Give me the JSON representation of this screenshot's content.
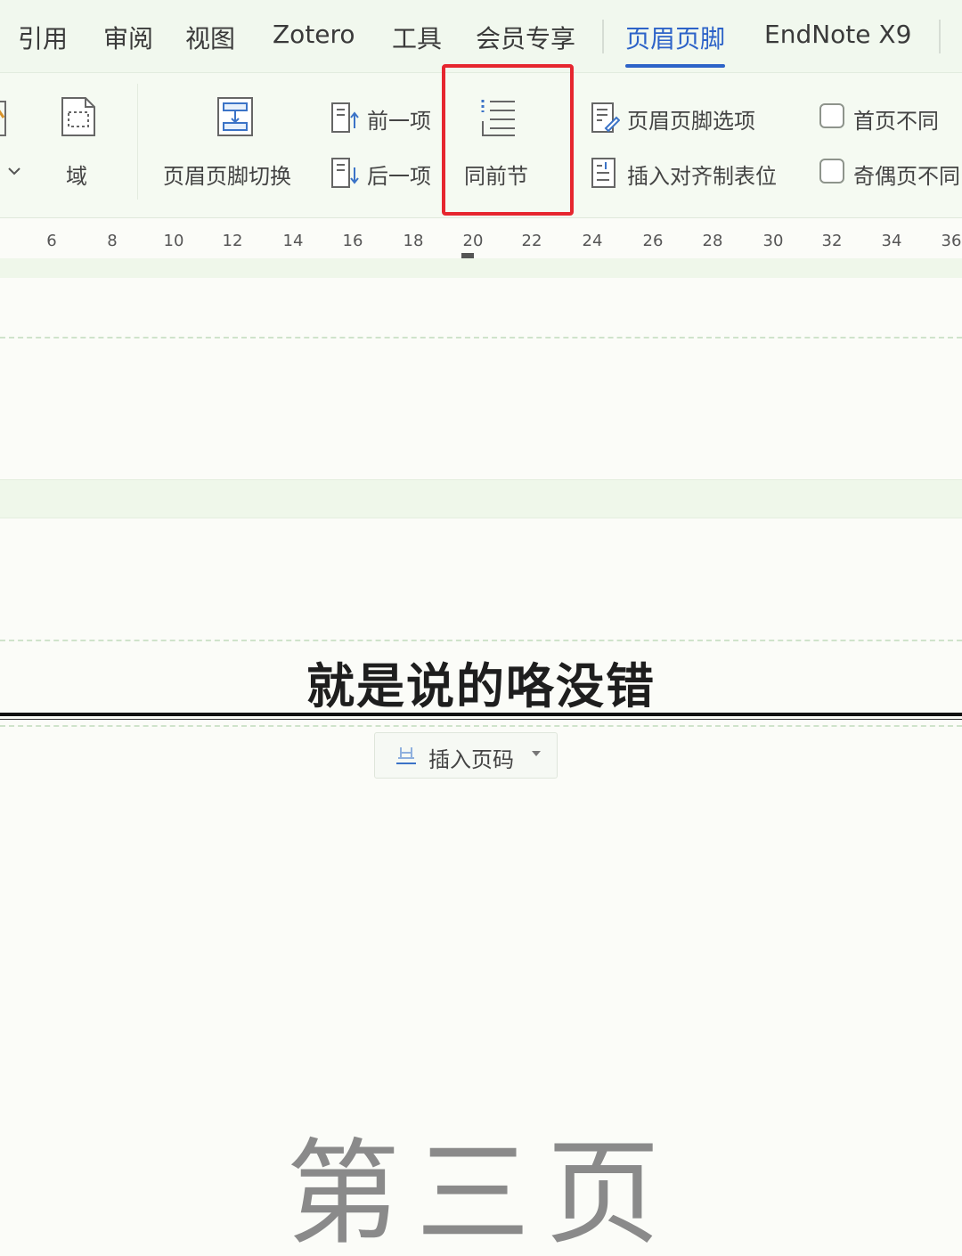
{
  "menu_tabs": [
    {
      "label": "引用"
    },
    {
      "label": "审阅"
    },
    {
      "label": "视图"
    },
    {
      "label": "Zotero"
    },
    {
      "label": "工具"
    },
    {
      "label": "会员专享"
    },
    {
      "label": "页眉页脚",
      "active": true
    },
    {
      "label": "EndNote X9"
    }
  ],
  "ribbon": {
    "field_label": "域",
    "switch_label": "页眉页脚切换",
    "prev_label": "前一项",
    "next_label": "后一项",
    "link_prev_label": "同前节",
    "options_label": "页眉页脚选项",
    "align_tab_label": "插入对齐制表位",
    "first_page_diff_label": "首页不同",
    "odd_even_diff_label": "奇偶页不同"
  },
  "ruler": {
    "ticks": [
      "6",
      "8",
      "10",
      "12",
      "14",
      "16",
      "18",
      "20",
      "22",
      "24",
      "26",
      "28",
      "30",
      "32",
      "34",
      "36"
    ]
  },
  "document": {
    "header_text": "就是说的咯没错",
    "insert_page_number_label": "插入页码",
    "body_text": "第三页"
  },
  "colors": {
    "accent": "#2d63c8",
    "highlight": "#e6262f",
    "ribbon_bg": "#f5faf2"
  },
  "icons": [
    "field-icon",
    "header-footer-switch-icon",
    "previous-item-icon",
    "next-item-icon",
    "link-to-previous-icon",
    "header-footer-options-icon",
    "insert-alignment-tab-icon",
    "page-number-icon"
  ]
}
